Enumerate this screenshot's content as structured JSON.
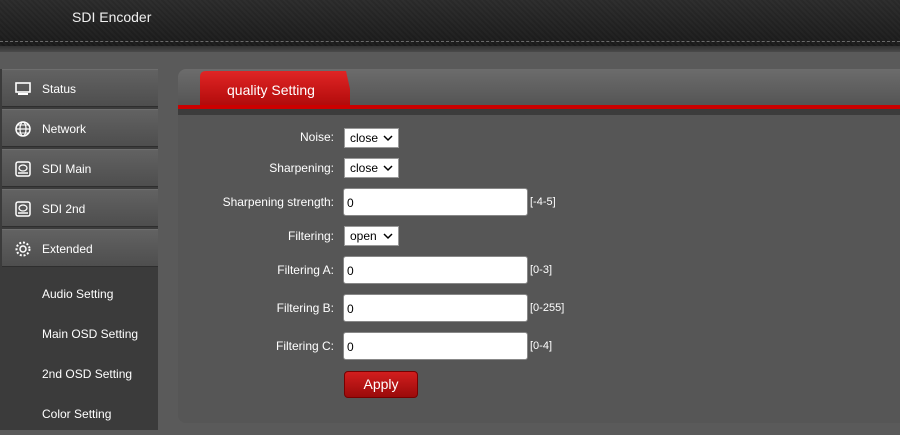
{
  "app": {
    "title": "SDI Encoder"
  },
  "sidebar": {
    "items": [
      {
        "label": "Status",
        "icon": "monitor-icon"
      },
      {
        "label": "Network",
        "icon": "globe-icon"
      },
      {
        "label": "SDI Main",
        "icon": "disk-icon"
      },
      {
        "label": "SDI 2nd",
        "icon": "disk-icon"
      },
      {
        "label": "Extended",
        "icon": "gear-icon"
      }
    ],
    "subitems": [
      {
        "label": "Audio Setting"
      },
      {
        "label": "Main OSD Setting"
      },
      {
        "label": "2nd OSD Setting"
      },
      {
        "label": "Color Setting"
      }
    ]
  },
  "panel": {
    "tab_label": "quality Setting",
    "accent_color": "#cc0000",
    "fields": {
      "noise": {
        "label": "Noise:",
        "value": "close"
      },
      "sharpening": {
        "label": "Sharpening:",
        "value": "close"
      },
      "sharpening_strength": {
        "label": "Sharpening strength:",
        "value": "0",
        "range": "[-4-5]"
      },
      "filtering": {
        "label": "Filtering:",
        "value": "open"
      },
      "filtering_a": {
        "label": "Filtering A:",
        "value": "0",
        "range": "[0-3]"
      },
      "filtering_b": {
        "label": "Filtering B:",
        "value": "0",
        "range": "[0-255]"
      },
      "filtering_c": {
        "label": "Filtering C:",
        "value": "0",
        "range": "[0-4]"
      }
    },
    "apply_label": "Apply"
  }
}
